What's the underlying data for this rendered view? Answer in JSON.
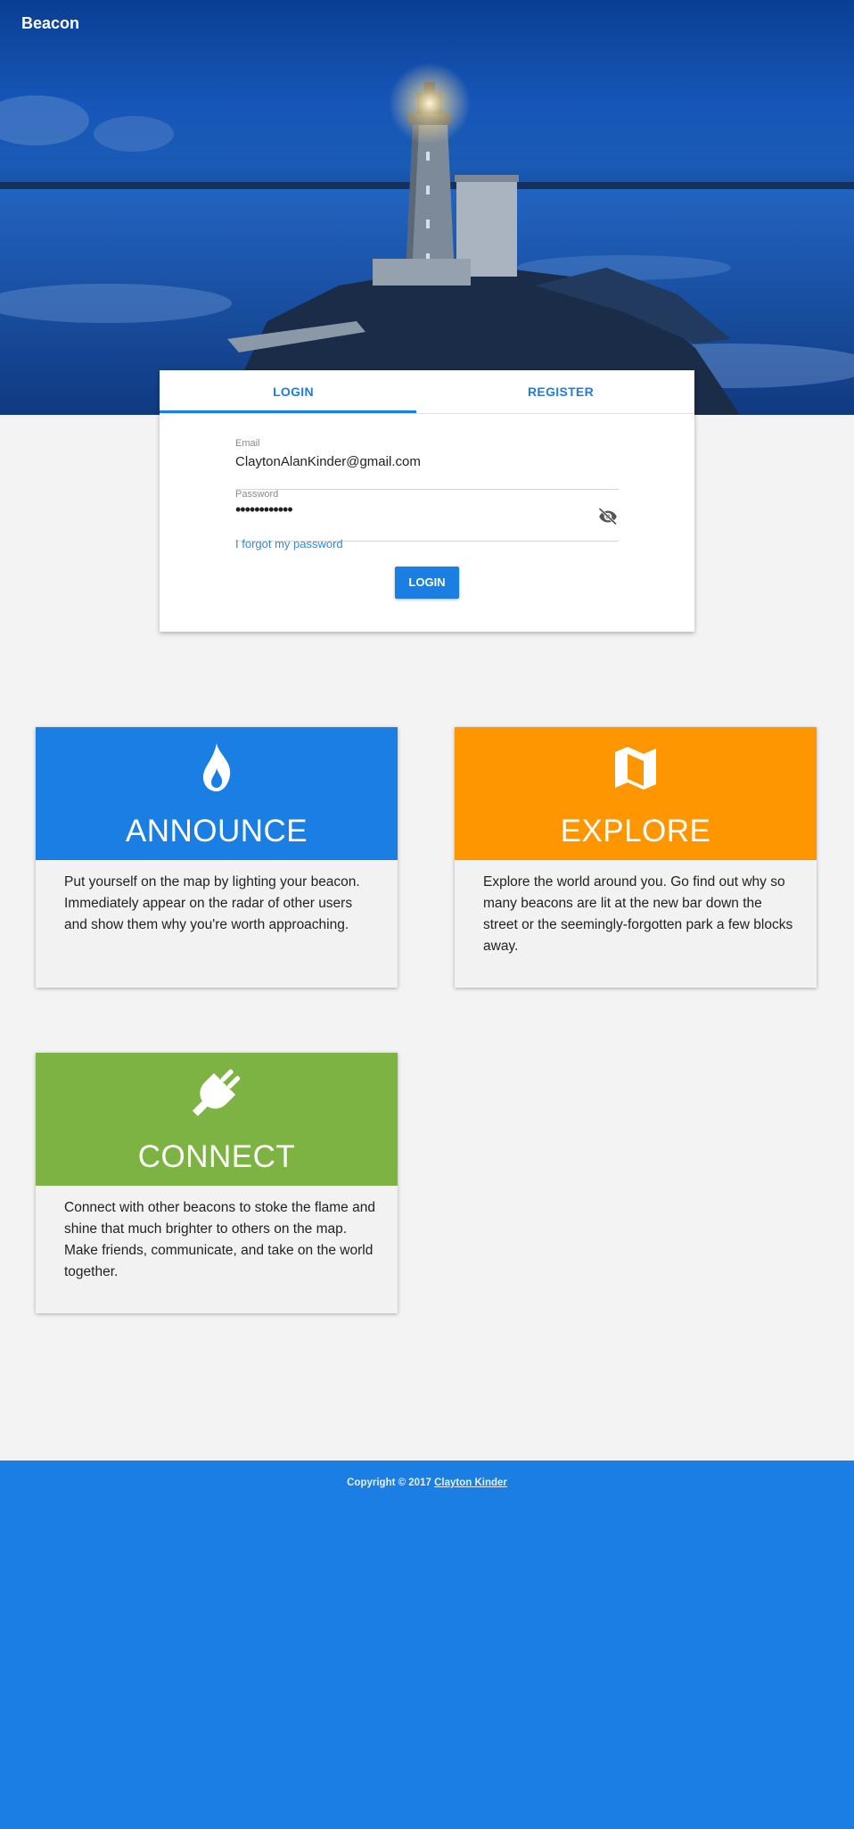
{
  "header": {
    "brand": "Beacon"
  },
  "auth": {
    "tabs": {
      "login": "LOGIN",
      "register": "REGISTER"
    },
    "email": {
      "label": "Email",
      "value": "ClaytonAlanKinder@gmail.com"
    },
    "password": {
      "label": "Password",
      "value": "••••••••••••"
    },
    "forgot_link": "I forgot my password",
    "submit_label": "LOGIN"
  },
  "features": {
    "announce": {
      "title": "ANNOUNCE",
      "body": "Put yourself on the map by lighting your beacon. Immediately appear on the radar of other users and show them why you're worth approaching.",
      "icon": "flame-icon",
      "color": "#1a7ee3"
    },
    "explore": {
      "title": "EXPLORE",
      "body": "Explore the world around you. Go find out why so many beacons are lit at the new bar down the street or the seemingly-forgotten park a few blocks away.",
      "icon": "map-icon",
      "color": "#fd9600"
    },
    "connect": {
      "title": "CONNECT",
      "body": "Connect with other beacons to stoke the flame and shine that much brighter to others on the map. Make friends, communicate, and take on the world together.",
      "icon": "plug-icon",
      "color": "#7db342"
    }
  },
  "footer": {
    "copyright": "Copyright © 2017",
    "author_link": "Clayton Kinder"
  }
}
